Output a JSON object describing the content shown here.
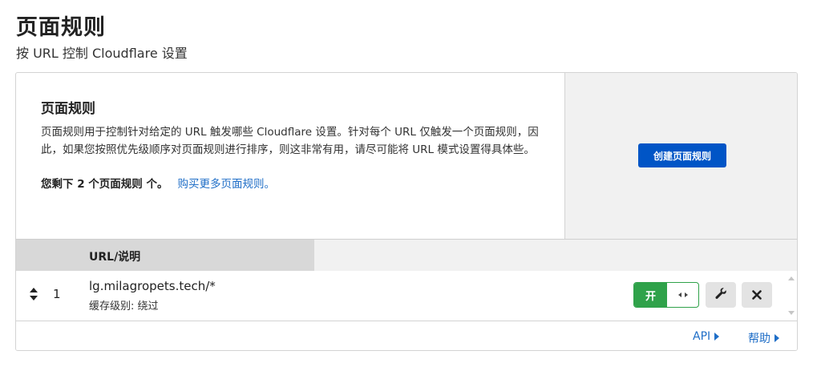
{
  "page": {
    "title": "页面规则",
    "subtitle": "按 URL 控制 Cloudflare 设置"
  },
  "intro": {
    "title": "页面规则",
    "description": "页面规则用于控制针对给定的 URL 触发哪些 Cloudflare 设置。针对每个 URL 仅触发一个页面规则，因此，如果您按照优先级顺序对页面规则进行排序，则这非常有用，请尽可能将 URL 模式设置得具体些。",
    "remaining_text": "您剩下 2 个页面规则 个。",
    "buy_more_link": "购买更多页面规则。"
  },
  "create_button_label": "创建页面规则",
  "table": {
    "header_url": "URL/说明",
    "rows": [
      {
        "index": "1",
        "url": "lg.milagropets.tech/*",
        "description": "缓存级别: 绕过",
        "toggle_label": "开",
        "enabled": true
      }
    ]
  },
  "footer": {
    "api_link": "API",
    "help_link": "帮助"
  },
  "colors": {
    "primary": "#0055c6",
    "toggle_on": "#2fa24a",
    "link": "#1f6ec7"
  },
  "icons": {
    "drag": "sort-arrows-icon",
    "edit": "wrench-icon",
    "delete": "close-icon",
    "toggle_knob": "left-right-arrows-icon"
  }
}
